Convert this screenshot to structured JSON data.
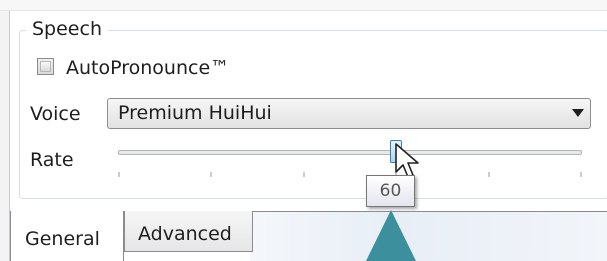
{
  "speech_group": {
    "title": "Speech",
    "autopronounce_label": "AutoPronounce™",
    "autopronounce_checked": false,
    "voice_label": "Voice",
    "voice_value": "Premium HuiHui",
    "rate_label": "Rate",
    "rate_value_fraction": 0.6,
    "rate_tooltip": "60"
  },
  "tabs": [
    {
      "label": "General",
      "selected": true
    },
    {
      "label": "Advanced",
      "selected": false
    }
  ],
  "colors": {
    "pointer_triangle": "#3c8f9c",
    "slider_thumb": "#a9d7f3"
  },
  "icons": {
    "dropdown": "chevron-down-icon",
    "cursor": "cursor-icon"
  }
}
